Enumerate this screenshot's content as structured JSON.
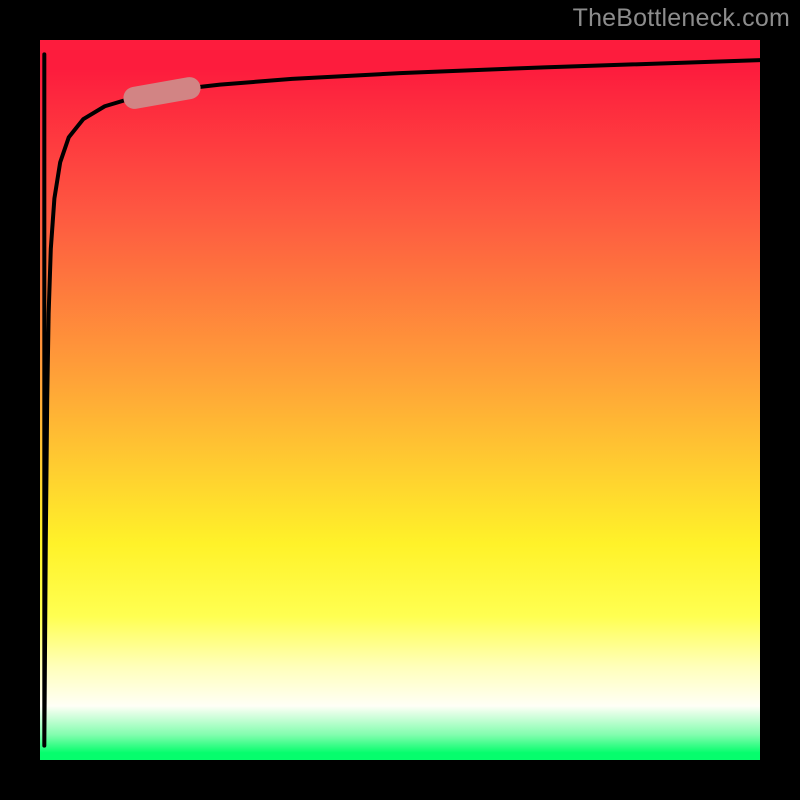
{
  "watermark": {
    "text": "TheBottleneck.com"
  },
  "chart_data": {
    "type": "line",
    "title": "",
    "xlabel": "",
    "ylabel": "",
    "xlim": [
      0,
      100
    ],
    "ylim": [
      0,
      100
    ],
    "series": [
      {
        "name": "curve",
        "x": [
          0.6,
          0.8,
          1.0,
          1.2,
          1.5,
          2.0,
          2.8,
          4.0,
          6.0,
          9.0,
          13.0,
          18.0,
          25.0,
          35.0,
          50.0,
          70.0,
          100.0
        ],
        "y": [
          2.0,
          30.0,
          50.0,
          62.0,
          71.0,
          78.0,
          83.0,
          86.5,
          89.0,
          90.8,
          92.0,
          93.0,
          93.8,
          94.6,
          95.4,
          96.2,
          97.2
        ]
      }
    ],
    "marker": {
      "series": "curve",
      "x_center": 17.0,
      "y_center": 92.7,
      "angle_deg": -10
    },
    "background_gradient": {
      "direction": "top-to-bottom",
      "stops": [
        {
          "pos": 0.0,
          "color": "#fd1c3d"
        },
        {
          "pos": 0.24,
          "color": "#fe5841"
        },
        {
          "pos": 0.47,
          "color": "#ffa238"
        },
        {
          "pos": 0.7,
          "color": "#fff229"
        },
        {
          "pos": 0.87,
          "color": "#ffffba"
        },
        {
          "pos": 0.97,
          "color": "#82fdae"
        },
        {
          "pos": 1.0,
          "color": "#06fd6d"
        }
      ]
    }
  }
}
